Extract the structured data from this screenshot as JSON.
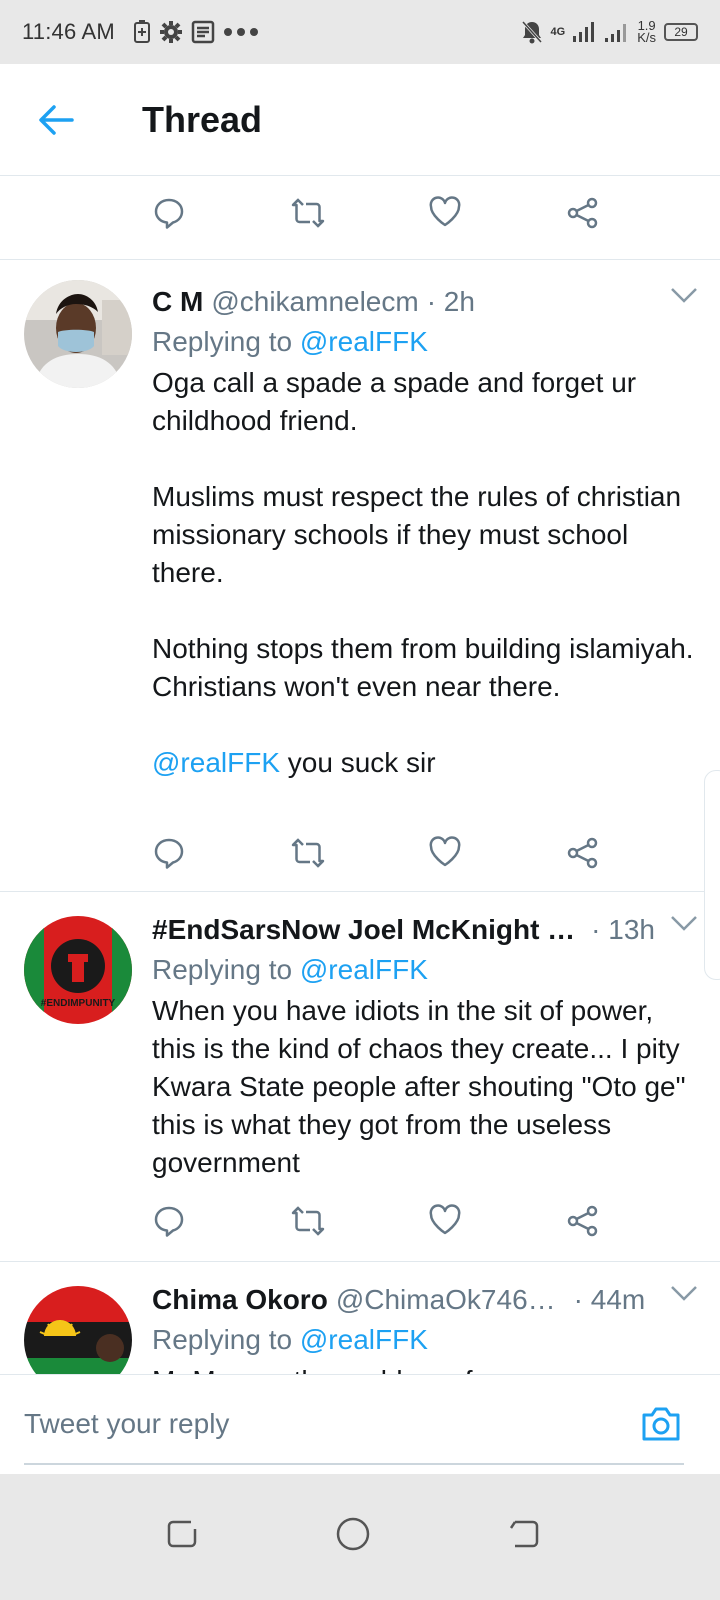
{
  "status_bar": {
    "time": "11:46 AM",
    "network": "4G",
    "speed_value": "1.9",
    "speed_unit": "K/s",
    "battery": "29"
  },
  "header": {
    "title": "Thread"
  },
  "tweets": [
    {
      "name": "C M",
      "handle": "@chikamnelecm",
      "time": "· 2h",
      "replying_prefix": "Replying to",
      "replying_handle": "@realFFK",
      "text": "Oga call a spade a spade and forget ur childhood friend.\n\nMuslims must respect the rules of christian missionary schools if they must school there.\n\nNothing stops them from building islamiyah. Christians won't even near there.\n\n",
      "mention": "@realFFK",
      "text_tail": " you suck sir"
    },
    {
      "name": "#EndSarsNow Joel McKnight …",
      "handle": "",
      "time": "· 13h",
      "replying_prefix": "Replying to",
      "replying_handle": "@realFFK",
      "text": "When you have idiots in the sit of power, this is the kind of chaos they create... I pity Kwara State people after shouting \"Oto ge\" this is what they got from the useless government",
      "avatar_text": "#ENDIMPUNITY"
    },
    {
      "name": "Chima Okoro",
      "handle": "@ChimaOk746…",
      "time": "· 44m",
      "replying_prefix": "Replying to",
      "replying_handle": "@realFFK",
      "text": "Mr Man...   the problem of ..."
    }
  ],
  "reply_bar": {
    "placeholder": "Tweet your reply"
  },
  "colors": {
    "accent": "#1da1f2",
    "secondary_text": "#657786",
    "divider": "#e1e8ed"
  }
}
